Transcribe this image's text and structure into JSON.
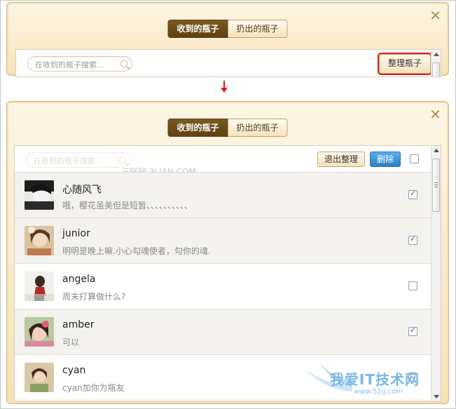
{
  "top_panel": {
    "tabs": [
      {
        "label": "收到的瓶子",
        "active": true
      },
      {
        "label": "扔出的瓶子",
        "active": false
      }
    ],
    "close_symbol": "✕",
    "search_placeholder": "在收到的瓶子搜索...",
    "manage_button": "整理瓶子"
  },
  "bottom_panel": {
    "tabs": [
      {
        "label": "收到的瓶子",
        "active": true
      },
      {
        "label": "扔出的瓶子",
        "active": false
      }
    ],
    "close_symbol": "✕",
    "search_placeholder": "在收到的瓶子搜索...",
    "exit_button": "退出整理",
    "delete_button": "删除",
    "watermark": "三联网 3LIAN.COM",
    "items": [
      {
        "name": "心随风飞",
        "message": "哦，樱花虽美但是短暂、、、、、、、、、、",
        "checked": true
      },
      {
        "name": "junior",
        "message": "明明是晚上嘛.小心勾魂使者，勾你的魂.",
        "checked": true
      },
      {
        "name": "angela",
        "message": "周末打算做什么?",
        "checked": false
      },
      {
        "name": "amber",
        "message": "可以",
        "checked": true
      },
      {
        "name": "cyan",
        "message": "cyan加你为瓶友",
        "checked": false
      }
    ]
  },
  "site_watermark": {
    "text": "我爱IT技术网",
    "url": "www.52ij.com"
  },
  "colors": {
    "accent_red": "#e11c1c",
    "tab_active": "#6b4c16",
    "delete_blue": "#2a7fc8",
    "panel_bg": "#f7e2b6"
  }
}
